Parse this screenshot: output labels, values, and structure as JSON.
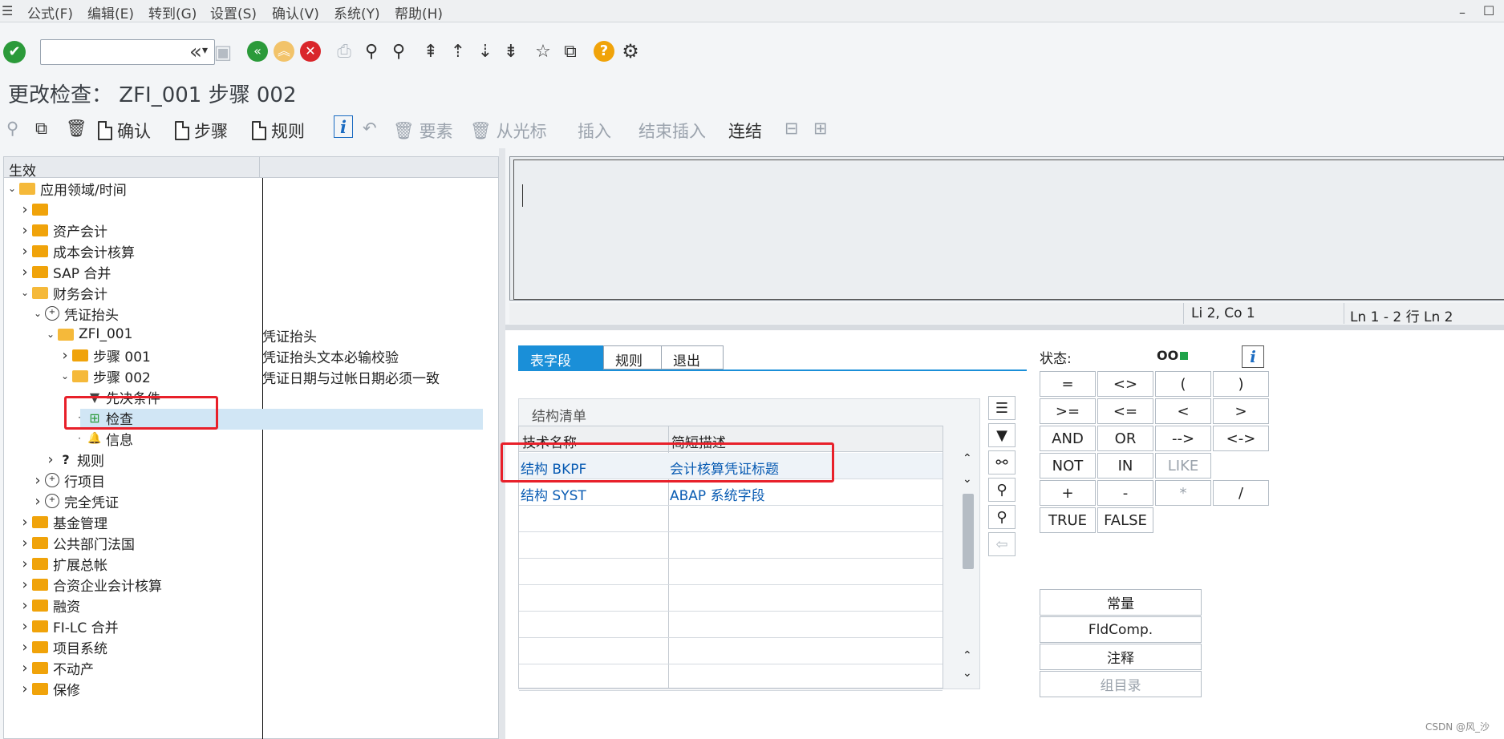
{
  "menubar": {
    "items": [
      "公式(F)",
      "编辑(E)",
      "转到(G)",
      "设置(S)",
      "确认(V)",
      "系统(Y)",
      "帮助(H)"
    ]
  },
  "window_title": "更改检查： ZFI_001 步骤 002",
  "command_field": {
    "value": "",
    "placeholder": ""
  },
  "app_toolbar": {
    "confirm": "确认",
    "step": "步骤",
    "rule": "规则",
    "element": "要素",
    "from_cursor": "从光标",
    "insert": "插入",
    "end_insert": "结束插入",
    "link": "连结"
  },
  "tree": {
    "header": "生效",
    "rows": [
      {
        "label": "应用领域/时间",
        "desc": ""
      },
      {
        "label": "",
        "desc": ""
      },
      {
        "label": "资产会计",
        "desc": ""
      },
      {
        "label": "成本会计核算",
        "desc": ""
      },
      {
        "label": "SAP 合并",
        "desc": ""
      },
      {
        "label": "财务会计",
        "desc": ""
      },
      {
        "label": "凭证抬头",
        "desc": ""
      },
      {
        "label": "ZFI_001",
        "desc": "凭证抬头"
      },
      {
        "label": "步骤 001",
        "desc": "凭证抬头文本必输校验"
      },
      {
        "label": "步骤 002",
        "desc": "凭证日期与过帐日期必须一致"
      },
      {
        "label": "先决条件",
        "desc": ""
      },
      {
        "label": "检查",
        "desc": ""
      },
      {
        "label": "信息",
        "desc": ""
      },
      {
        "label": "规则",
        "desc": ""
      },
      {
        "label": "行项目",
        "desc": ""
      },
      {
        "label": "完全凭证",
        "desc": ""
      },
      {
        "label": "基金管理",
        "desc": ""
      },
      {
        "label": "公共部门法国",
        "desc": ""
      },
      {
        "label": "扩展总帐",
        "desc": ""
      },
      {
        "label": "合资企业会计核算",
        "desc": ""
      },
      {
        "label": "融资",
        "desc": ""
      },
      {
        "label": "FI-LC 合并",
        "desc": ""
      },
      {
        "label": "项目系统",
        "desc": ""
      },
      {
        "label": "不动产",
        "desc": ""
      },
      {
        "label": "保修",
        "desc": ""
      }
    ]
  },
  "editor": {
    "status_pos": "Li 2, Co 1",
    "status_lines": "Ln 1 - 2 行 Ln 2"
  },
  "tabs": [
    "表字段",
    "规则",
    "退出"
  ],
  "structure": {
    "caption": "结构清单",
    "col1": "技术名称",
    "col2": "简短描述",
    "rows": [
      {
        "name": "结构 BKPF",
        "desc": "会计核算凭证标题"
      },
      {
        "name": "结构 SYST",
        "desc": "ABAP 系统字段"
      }
    ]
  },
  "operators": {
    "status_label": "状态:",
    "status_ind": "OO",
    "rows": [
      [
        "=",
        "<>",
        "(",
        ")"
      ],
      [
        ">=",
        "<=",
        "<",
        ">"
      ],
      [
        "AND",
        "OR",
        "-->",
        "<->"
      ],
      [
        "NOT",
        "IN",
        "LIKE",
        ""
      ],
      [
        "+",
        "-",
        "*",
        "/"
      ],
      [
        "TRUE",
        "FALSE",
        "",
        ""
      ]
    ],
    "buttons": [
      "常量",
      "FldComp.",
      "注释",
      "组目录"
    ]
  },
  "watermark": "CSDN @风_沙",
  "colors": {
    "accent": "#1a8fd8",
    "highlight": "#d1e6f5",
    "annotation": "#e8202a"
  }
}
